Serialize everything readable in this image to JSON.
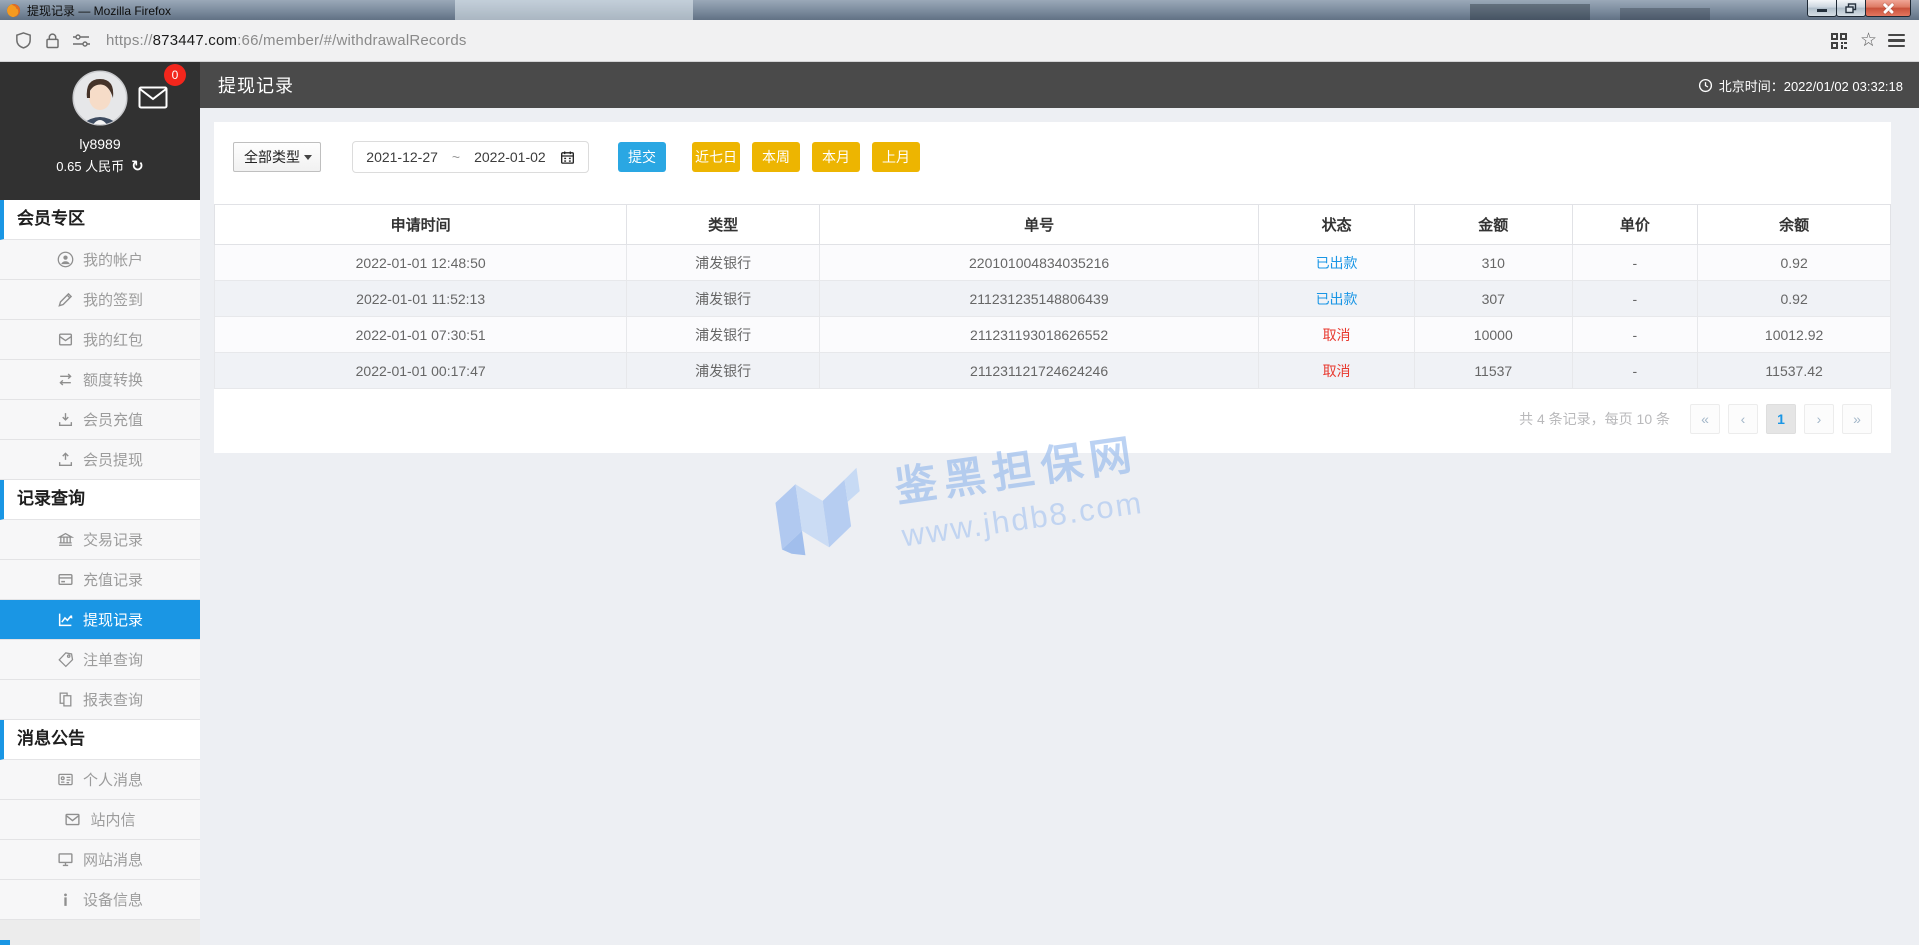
{
  "browser": {
    "window_title": "提现记录 — Mozilla Firefox",
    "url": {
      "prefix": "https://",
      "domain": "873447.com",
      "path": ":66/member/#/withdrawalRecords"
    }
  },
  "icons": {
    "star": "☆",
    "refresh": "↻"
  },
  "profile": {
    "username": "ly8989",
    "balance": "0.65 人民币",
    "mail_badge": "0"
  },
  "sidebar": {
    "sections": [
      {
        "title": "会员专区",
        "items": [
          {
            "label": "我的帐户"
          },
          {
            "label": "我的签到"
          },
          {
            "label": "我的红包"
          },
          {
            "label": "额度转换"
          },
          {
            "label": "会员充值"
          },
          {
            "label": "会员提现"
          }
        ]
      },
      {
        "title": "记录查询",
        "items": [
          {
            "label": "交易记录"
          },
          {
            "label": "充值记录"
          },
          {
            "label": "提现记录",
            "active": true
          },
          {
            "label": "注单查询"
          },
          {
            "label": "报表查询"
          }
        ]
      },
      {
        "title": "消息公告",
        "items": [
          {
            "label": "个人消息"
          },
          {
            "label": "站内信"
          },
          {
            "label": "网站消息"
          },
          {
            "label": "设备信息"
          }
        ]
      }
    ]
  },
  "header": {
    "title": "提现记录",
    "beijing_time": "北京时间：2022/01/02 03:32:18"
  },
  "filters": {
    "type_select_value": "全部类型",
    "date_start": "2021-12-27",
    "date_separator": "~",
    "date_end": "2022-01-02",
    "submit_label": "提交",
    "quick_buttons": [
      "近七日",
      "本周",
      "本月",
      "上月"
    ]
  },
  "table": {
    "headers": [
      "申请时间",
      "类型",
      "单号",
      "状态",
      "金额",
      "单价",
      "余额"
    ],
    "rows": [
      {
        "time": "2022-01-01 12:48:50",
        "type": "浦发银行",
        "order_no": "220101004834035216",
        "status": "已出款",
        "status_kind": "paid",
        "amount": "310",
        "unit_price": "-",
        "balance": "0.92"
      },
      {
        "time": "2022-01-01 11:52:13",
        "type": "浦发银行",
        "order_no": "211231235148806439",
        "status": "已出款",
        "status_kind": "paid",
        "amount": "307",
        "unit_price": "-",
        "balance": "0.92"
      },
      {
        "time": "2022-01-01 07:30:51",
        "type": "浦发银行",
        "order_no": "211231193018626552",
        "status": "取消",
        "status_kind": "cancel",
        "amount": "10000",
        "unit_price": "-",
        "balance": "10012.92"
      },
      {
        "time": "2022-01-01 00:17:47",
        "type": "浦发银行",
        "order_no": "211231121724624246",
        "status": "取消",
        "status_kind": "cancel",
        "amount": "11537",
        "unit_price": "-",
        "balance": "11537.42"
      }
    ]
  },
  "pagination": {
    "summary": "共 4 条记录，每页 10 条",
    "first": "«",
    "prev": "‹",
    "current_page": "1",
    "next": "›",
    "last": "»"
  },
  "watermark": {
    "site_name": "鉴黑担保网",
    "site_url": "www.jhdb8.com"
  },
  "colors": {
    "accent_blue": "#1a96e4",
    "submit_blue": "#2aa7e3",
    "quick_gold": "#edb501",
    "status_paid": "#1a96e5",
    "status_cancel": "#e8392f",
    "badge_red": "#f3261c"
  }
}
